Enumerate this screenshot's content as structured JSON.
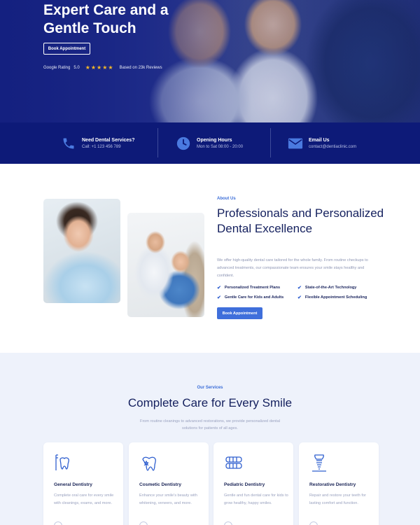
{
  "colors": {
    "navy": "#0d1a78",
    "accent": "#3f6fdb",
    "star": "#f4b928",
    "services_bg": "#eef2fb"
  },
  "hero": {
    "title": "Expert Care and a Gentle Touch",
    "cta_label": "Book Appointment",
    "rating_label": "Google Rating",
    "rating_value": "5.0",
    "stars": "★★★★★",
    "reviews_text": "Based on 23k Reviews"
  },
  "info_bar": [
    {
      "icon": "phone-icon",
      "title": "Need Dental Services?",
      "subtitle": "Call: +1 123 456 789"
    },
    {
      "icon": "clock-icon",
      "title": "Opening Hours",
      "subtitle": "Mon to Sat 08:00 - 20:00"
    },
    {
      "icon": "mail-icon",
      "title": "Email Us",
      "subtitle": "contact@dentiaclinic.com"
    }
  ],
  "about": {
    "eyebrow": "About Us",
    "title": "Professionals and Personalized Dental Excellence",
    "description": "We offer high-quality dental care tailored for the whole family. From routine checkups to advanced treatments, our compassionate team ensures your smile stays healthy and confident.",
    "features": [
      "Personalized Treatment Plans",
      "State-of-the-Art Technology",
      "Gentle Care for Kids and Adults",
      "Flexible Appointment Scheduling"
    ],
    "cta_label": "Book Appointment"
  },
  "services": {
    "eyebrow": "Our Services",
    "title": "Complete Care for Every Smile",
    "description": "From routine cleanings to advanced restorations, we provide personalized dental solutions for patients of all ages.",
    "cards": [
      {
        "icon": "tooth-brush-icon",
        "title": "General Dentistry",
        "description": "Complete oral care for every smile with cleanings, exams, and more."
      },
      {
        "icon": "sparkle-tooth-icon",
        "title": "Cosmetic Dentistry",
        "description": "Enhance your smile's beauty with whitening, veneers, and more."
      },
      {
        "icon": "teeth-brace-icon",
        "title": "Pediatric Dentistry",
        "description": "Gentle and fun dental care for kids to grow healthy, happy smiles."
      },
      {
        "icon": "implant-icon",
        "title": "Restorative Dentistry",
        "description": "Repair and restore your teeth for lasting comfort and function."
      }
    ]
  }
}
